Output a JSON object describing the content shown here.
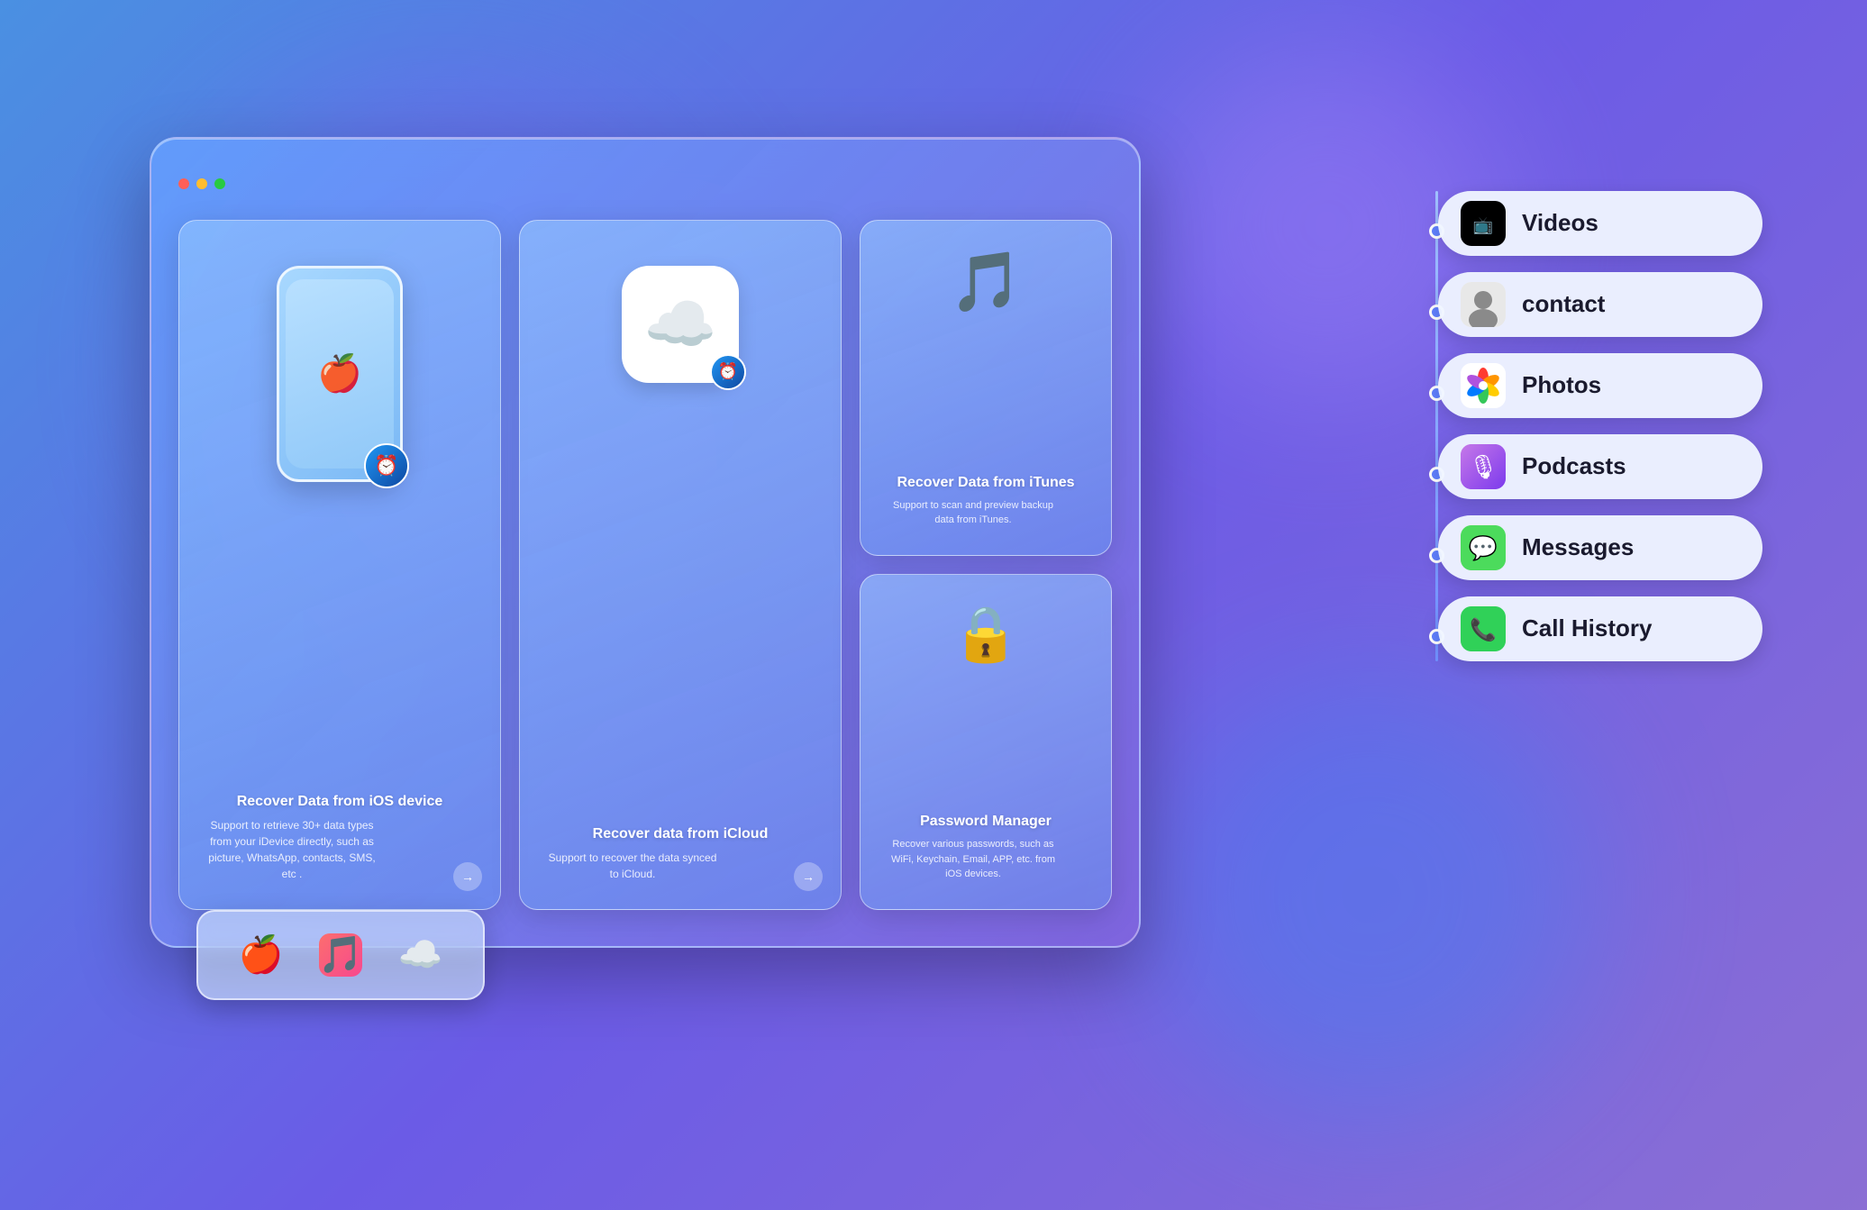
{
  "background": {
    "gradient_start": "#4a90e2",
    "gradient_end": "#6b5be6"
  },
  "app_window": {
    "cards": [
      {
        "id": "ios-device",
        "title": "Recover Data from iOS device",
        "description": "Support to retrieve 30+ data types from your iDevice directly, such as picture, WhatsApp, contacts, SMS, etc .",
        "icon": "iphone",
        "arrow": "→"
      },
      {
        "id": "icloud",
        "title": "Recover data from iCloud",
        "description": "Support to recover the data synced to iCloud.",
        "icon": "icloud",
        "arrow": "→"
      },
      {
        "id": "itunes",
        "title": "Recover Data from iTunes",
        "description": "Support to scan and preview backup data from iTunes.",
        "icon": "music",
        "arrow": ""
      },
      {
        "id": "password",
        "title": "Password Manager",
        "description": "Recover various passwords, such as WiFi, Keychain, Email, APP, etc. from iOS devices.",
        "icon": "lock",
        "arrow": ""
      }
    ]
  },
  "bottom_tabs": [
    {
      "id": "ios",
      "icon": "🍎",
      "label": "iOS"
    },
    {
      "id": "itunes",
      "icon": "🎵",
      "label": "iTunes"
    },
    {
      "id": "icloud",
      "icon": "☁️",
      "label": "iCloud"
    }
  ],
  "feature_list": [
    {
      "id": "videos",
      "label": "Videos",
      "icon_type": "apple-tv",
      "icon_char": ""
    },
    {
      "id": "contact",
      "label": "contact",
      "icon_type": "contacts-icon",
      "icon_char": "👤"
    },
    {
      "id": "photos",
      "label": "Photos",
      "icon_type": "photos-icon",
      "icon_char": "🌸"
    },
    {
      "id": "podcasts",
      "label": "Podcasts",
      "icon_type": "podcasts-icon",
      "icon_char": "🎙"
    },
    {
      "id": "messages",
      "label": "Messages",
      "icon_type": "messages-icon",
      "icon_char": "💬"
    },
    {
      "id": "call-history",
      "label": "Call History",
      "icon_type": "calls-icon",
      "icon_char": "📞"
    }
  ]
}
